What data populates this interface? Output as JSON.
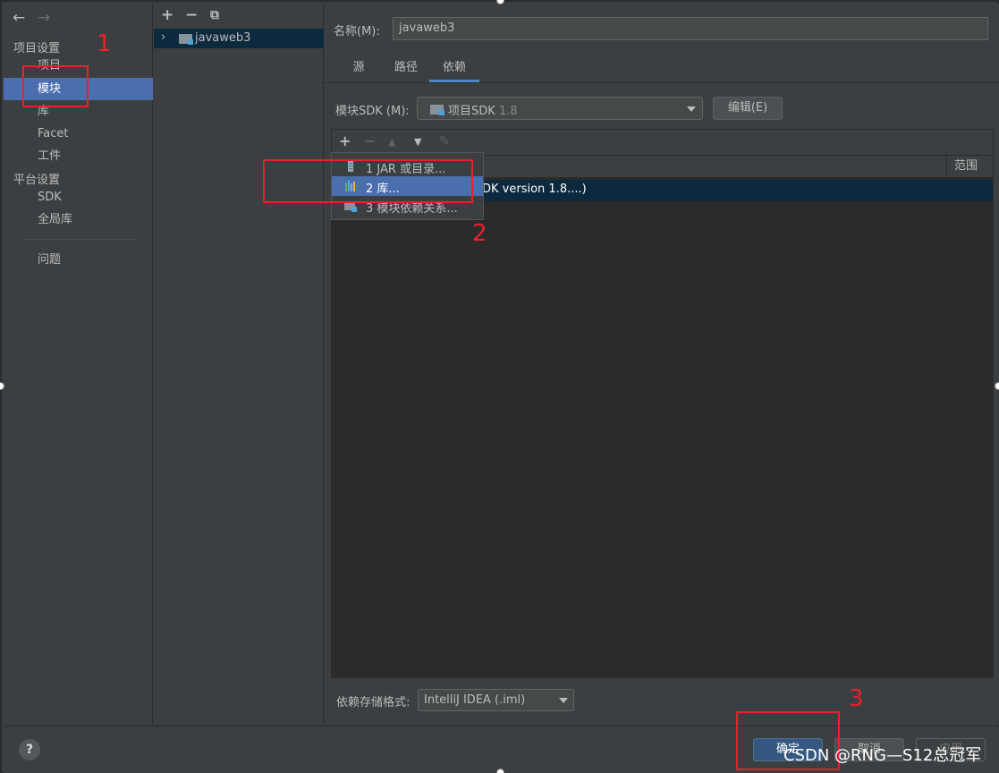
{
  "nav": {
    "back_icon": "arrow-left-icon",
    "forward_icon": "arrow-right-icon",
    "project_settings": "项目设置",
    "items_project": [
      "项目",
      "模块",
      "库",
      "Facet",
      "工件"
    ],
    "platform_settings": "平台设置",
    "items_platform": [
      "SDK",
      "全局库"
    ],
    "problems": "问题"
  },
  "tree": {
    "toolbar_icons": [
      "add-icon",
      "remove-icon",
      "copy-icon"
    ],
    "module_name": "javaweb3"
  },
  "main": {
    "name_label": "名称(M):",
    "name_value": "javaweb3",
    "tabs": [
      "源",
      "路径",
      "依赖"
    ],
    "selected_tab": "依赖",
    "sdk_label": "模块SDK (M):",
    "sdk_value": "项目SDK",
    "sdk_version": "1.8",
    "edit_button": "编辑(E)",
    "dep_scope_header": "范围",
    "dep_row_text": "DK version 1.8....)",
    "storage_label": "依赖存储格式:",
    "storage_value": "IntelliJ IDEA (.iml)"
  },
  "popup": {
    "items": [
      "1  JAR 或目录...",
      "2  库...",
      "3  模块依赖关系..."
    ],
    "selected_index": 1
  },
  "footer": {
    "help": "?",
    "ok": "确定",
    "cancel": "取消",
    "apply": "应用"
  },
  "annotations": {
    "marks": [
      "1",
      "2",
      "3"
    ],
    "color": "#e8212b"
  },
  "watermark": "CSDN @RNG—S12总冠军",
  "colors": {
    "background": "#3c3f41",
    "selection": "#4b6eaf",
    "tree_selection": "#0d293e",
    "primary_button": "#365880"
  }
}
